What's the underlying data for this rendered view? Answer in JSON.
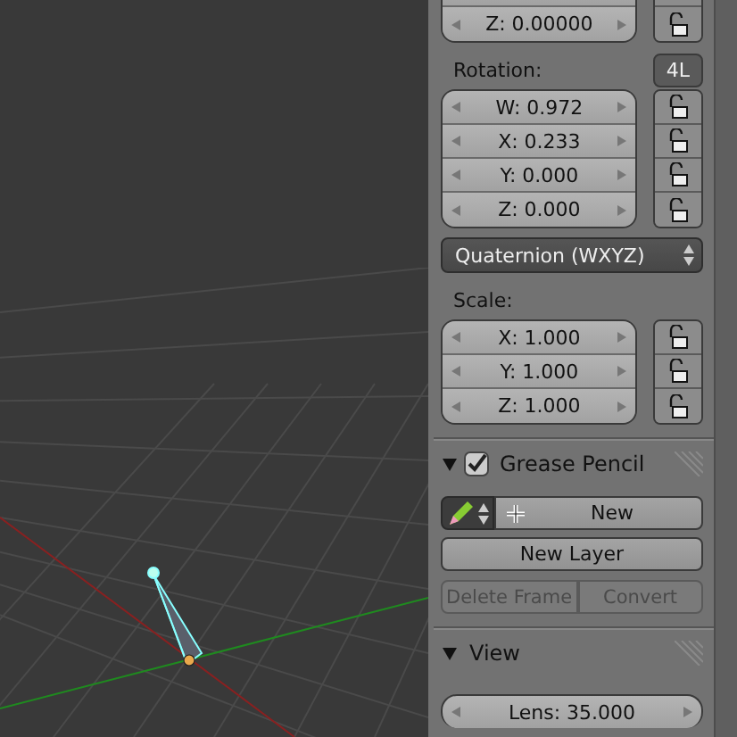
{
  "location": {
    "fields": [
      {
        "text": "Z: 0.00000",
        "locked": false
      }
    ]
  },
  "rotation": {
    "label": "Rotation:",
    "mode_button": "4L",
    "fields": [
      {
        "text": "W: 0.972",
        "locked": false
      },
      {
        "text": "X: 0.233",
        "locked": false
      },
      {
        "text": "Y: 0.000",
        "locked": false
      },
      {
        "text": "Z: 0.000",
        "locked": false
      }
    ],
    "mode": "Quaternion (WXYZ)"
  },
  "scale": {
    "label": "Scale:",
    "fields": [
      {
        "text": "X: 1.000",
        "locked": false
      },
      {
        "text": "Y: 1.000",
        "locked": false
      },
      {
        "text": "Z: 1.000",
        "locked": false
      }
    ]
  },
  "grease_pencil": {
    "title": "Grease Pencil",
    "expanded": true,
    "enabled": true,
    "new_button": "New",
    "new_layer_button": "New Layer",
    "buttons": [
      {
        "label": "Delete Frame",
        "disabled": true
      },
      {
        "label": "Convert",
        "disabled": true
      }
    ]
  },
  "view": {
    "title": "View",
    "expanded": true,
    "lens": "Lens: 35.000"
  }
}
